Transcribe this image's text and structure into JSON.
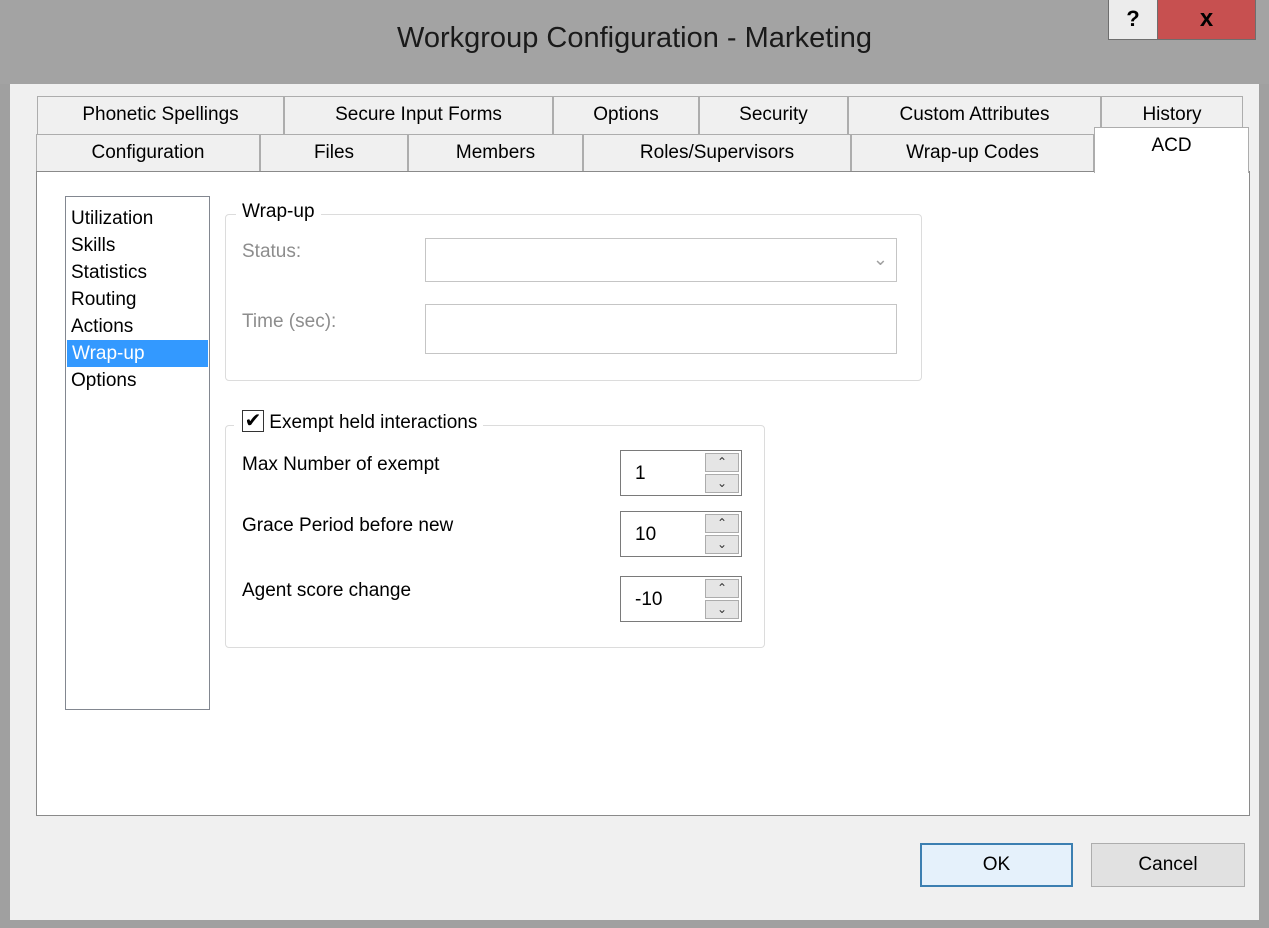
{
  "window": {
    "title": "Workgroup Configuration - Marketing",
    "help_label": "?",
    "close_label": "x"
  },
  "tabs": {
    "row1": [
      "Phonetic Spellings",
      "Secure Input Forms",
      "Options",
      "Security",
      "Custom Attributes",
      "History"
    ],
    "row2": [
      "Configuration",
      "Files",
      "Members",
      "Roles/Supervisors",
      "Wrap-up Codes",
      "ACD"
    ],
    "active": "ACD"
  },
  "nav": {
    "items": [
      "Utilization",
      "Skills",
      "Statistics",
      "Routing",
      "Actions",
      "Wrap-up",
      "Options"
    ],
    "selected": "Wrap-up"
  },
  "wrapup": {
    "legend": "Wrap-up",
    "status_label": "Status:",
    "status_value": "",
    "time_label": "Time (sec):",
    "time_value": ""
  },
  "exempt": {
    "legend": "Exempt held interactions",
    "checked": true,
    "check_glyph": "✔",
    "fields": [
      {
        "label": "Max Number of exempt",
        "value": "1"
      },
      {
        "label": "Grace Period before new",
        "value": "10"
      },
      {
        "label": "Agent score change",
        "value": "-10"
      }
    ]
  },
  "buttons": {
    "ok": "OK",
    "cancel": "Cancel"
  }
}
